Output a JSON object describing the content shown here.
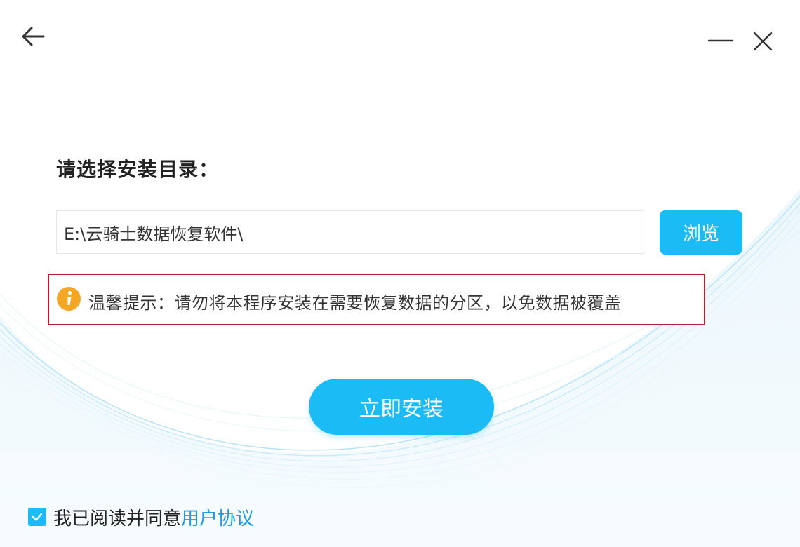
{
  "titlebar": {
    "back_icon": "arrow-left-icon",
    "minimize_icon": "minimize-icon",
    "close_icon": "close-icon"
  },
  "install_dir": {
    "label": "请选择安装目录：",
    "path_value": "E:\\云骑士数据恢复软件\\",
    "browse_label": "浏览"
  },
  "warning": {
    "icon": "info-icon",
    "text": "温馨提示：请勿将本程序安装在需要恢复数据的分区，以免数据被覆盖"
  },
  "install_button": {
    "label": "立即安装"
  },
  "agreement": {
    "checked": true,
    "text": "我已阅读并同意",
    "link_label": "用户协议"
  },
  "colors": {
    "accent": "#1bbcf5",
    "link": "#1a9be6",
    "warning_border": "#b3202a",
    "info_icon": "#f5a623"
  }
}
